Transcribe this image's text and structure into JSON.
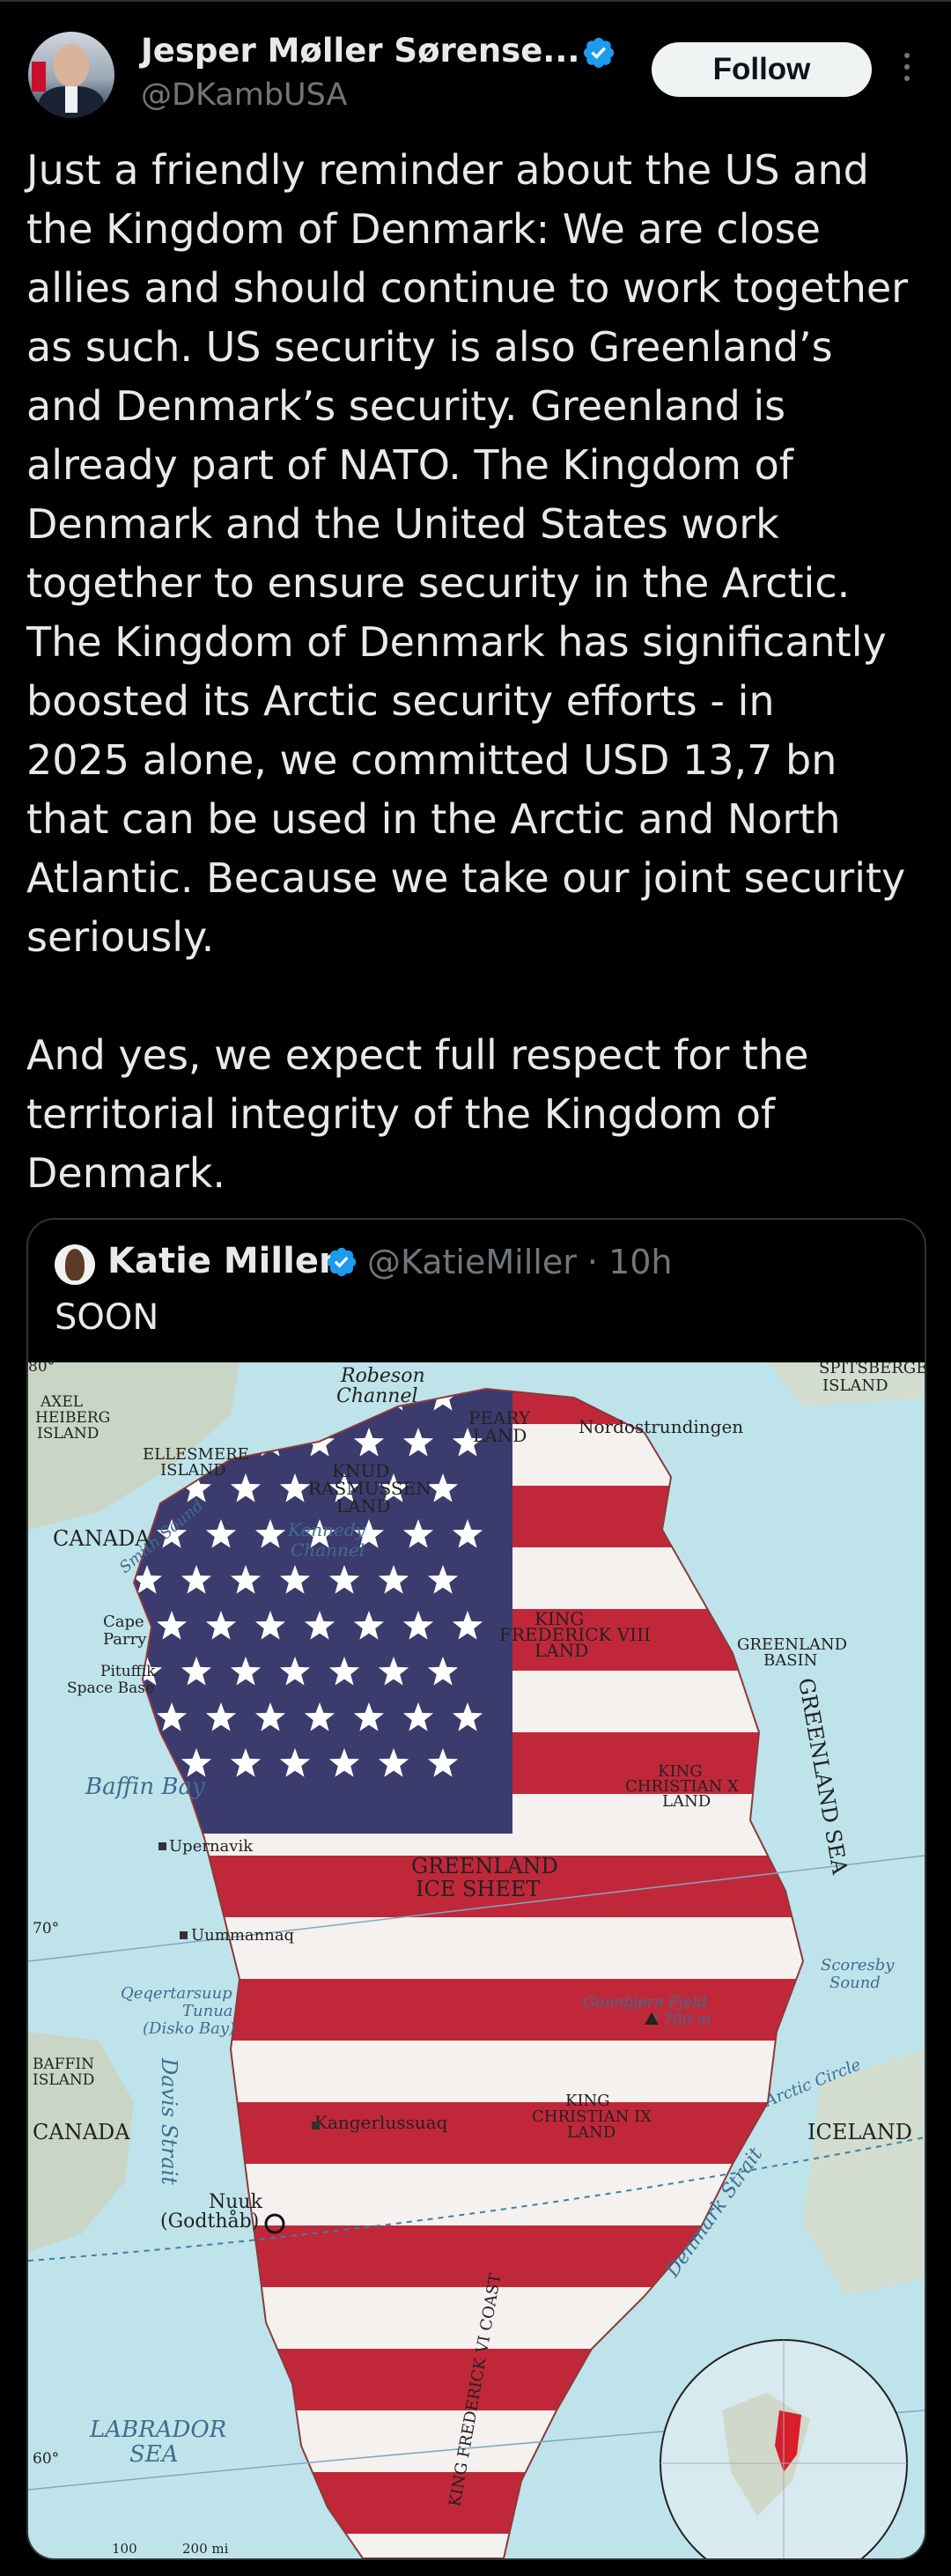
{
  "post": {
    "author_name": "Jesper Møller Sørense...",
    "handle": "@DKambUSA",
    "follow_label": "Follow",
    "text": "Just a friendly reminder about the US and\nthe Kingdom of Denmark: We are close\nallies and should continue to work together\nas such. US security is also Greenland’s\nand Denmark’s security. Greenland is\nalready part of NATO. The Kingdom of\nDenmark and the United States work\ntogether to ensure security in the Arctic.\nThe Kingdom of Denmark has significantly\nboosted its Arctic security efforts - in\n2025 alone, we committed USD 13,7 bn\nthat can be used in the Arctic and North\nAtlantic. Because we take our joint security\nseriously.\n\nAnd yes, we expect full respect for the\nterritorial integrity of the Kingdom of\nDenmark."
  },
  "quote": {
    "author_name": "Katie Miller",
    "handle_time": "@KatieMiller · 10h",
    "text": "SOON"
  },
  "map": {
    "labels": {
      "robeson": "Robeson",
      "channel": "Channel",
      "peary": "PEARY",
      "land": "LAND",
      "nordostrundingen": "Nordostrundingen",
      "spitsbergen": "SPITSBERGEN",
      "island": "ISLAND",
      "axel": "AXEL",
      "heiberg": "HEIBERG",
      "ellesmere": "ELLESMERE",
      "knud": "KNUD",
      "rasmussen": "RASMUSSEN",
      "canada": "CANADA",
      "smith_sound": "Smith Sound",
      "kennedy": "Kennedy",
      "cape": "Cape",
      "parry": "Parry",
      "pituffik": "Pituffik",
      "space_base": "Space Base",
      "king": "KING",
      "frederick_viii": "FREDERICK VIII",
      "greenland": "GREENLAND",
      "basin": "BASIN",
      "greenland_sea": "GREENLAND SEA",
      "baffin_bay": "Baffin Bay",
      "christian_x": "CHRISTIAN X",
      "upernavik": "Upernavik",
      "ice_sheet": "ICE SHEET",
      "lat70": "70°",
      "uummannaq": "Uummannaq",
      "scoresby": "Scoresby",
      "sound": "Sound",
      "qeqertarsuup": "Qeqertarsuup",
      "tunua": "Tunua",
      "disko_bay": "(Disko Bay)",
      "gunnbjorn": "Gunnbjørn Fjeld",
      "gunnbjorn_height": "3 700 m",
      "baffin": "BAFFIN",
      "davis_strait": "Davis Strait",
      "christian_ix": "CHRISTIAN IX",
      "arctic_circle": "Arctic Circle",
      "kangerlussuaq": "Kangerlussuaq",
      "iceland": "ICELAND",
      "denmark_strait": "Denmark Strait",
      "nuuk": "Nuuk",
      "godthab": "(Godthåb)",
      "king_frederick_vi_coast": "KING FREDERICK VI COAST",
      "labrador": "LABRADOR",
      "sea": "SEA",
      "lat60": "60°",
      "lat80": "80°",
      "scale_100": "100",
      "scale_200": "200 mi"
    },
    "colors": {
      "sea": "#bfe3ea",
      "stripe_red": "#c0283a",
      "stripe_white": "#f4f1ee",
      "canton_blue": "#3c3b6e",
      "land": "#c9d6c6"
    }
  }
}
